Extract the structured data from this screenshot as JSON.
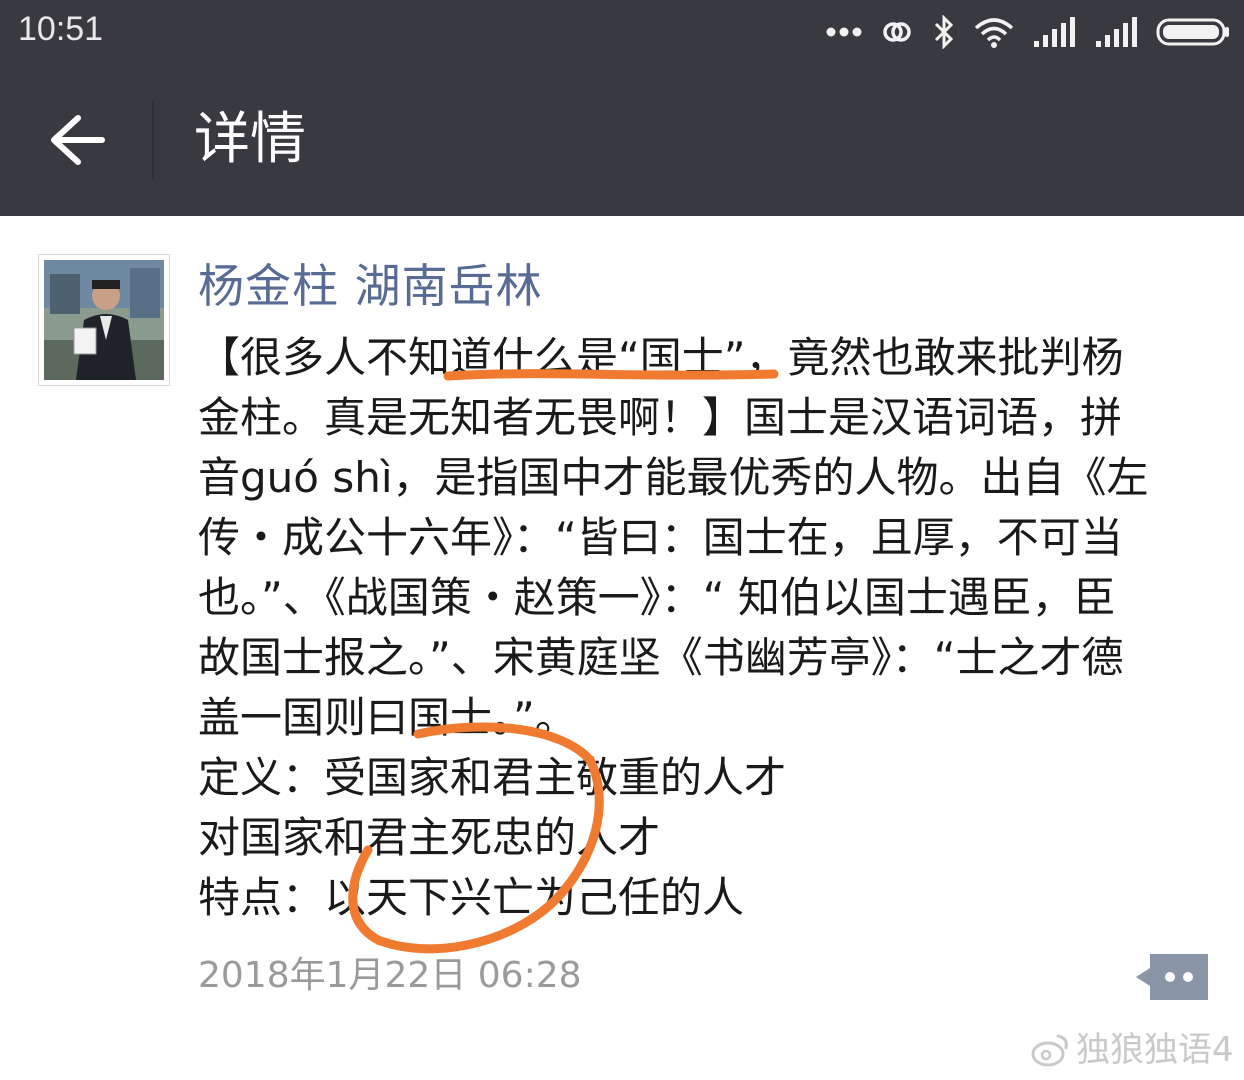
{
  "status_bar": {
    "time": "10:51"
  },
  "nav": {
    "title": "详情"
  },
  "post": {
    "author": "杨金柱 湖南岳林",
    "lines": [
      "【很多人不知道什么是“国士”，竟然也敢来批判杨",
      "金柱。真是无知者无畏啊！】国士是汉语词语，拼",
      "音guó shì，是指国中才能最优秀的人物。出自《左",
      "传・成公十六年》：“皆曰：国士在，且厚，不可当",
      "也。”、《战国策・赵策一》：“ 知伯以国士遇臣，臣",
      "故国士报之。”、宋黄庭坚《书幽芳亭》：“士之才德",
      "盖一国则曰国士。”。",
      "定义：受国家和君主敬重的人才",
      "对国家和君主死忠的人才",
      "特点：以天下兴亡为己任的人"
    ],
    "timestamp": "2018年1月22日 06:28"
  },
  "watermark": {
    "text": "独狼独语4"
  },
  "colors": {
    "header_bg": "#393a3f",
    "author_link": "#576b95",
    "annotation_orange": "#f07a30",
    "timestamp": "#9a9a9a"
  }
}
